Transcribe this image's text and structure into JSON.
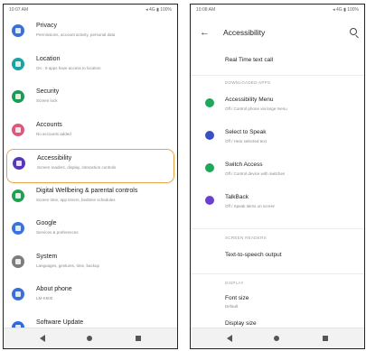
{
  "left_phone": {
    "status": {
      "time": "10:07 AM",
      "icons": "◂ 4G ▮ 100%"
    },
    "items": [
      {
        "title": "Privacy",
        "subtitle": "Permissions, account activity, personal data",
        "color": "#3b6fd9"
      },
      {
        "title": "Location",
        "subtitle": "On · 9 apps have access to location",
        "color": "#19a3a3"
      },
      {
        "title": "Security",
        "subtitle": "Screen lock",
        "color": "#1e9a52"
      },
      {
        "title": "Accounts",
        "subtitle": "No accounts added",
        "color": "#e0577b"
      },
      {
        "title": "Accessibility",
        "subtitle": "Screen readers, display, interaction controls",
        "color": "#5a37b8"
      },
      {
        "title": "Digital Wellbeing & parental controls",
        "subtitle": "Screen time, app timers, bedtime schedules",
        "color": "#21a054"
      },
      {
        "title": "Google",
        "subtitle": "Services & preferences",
        "color": "#3a73e0"
      },
      {
        "title": "System",
        "subtitle": "Languages, gestures, time, backup",
        "color": "#7d7d7d"
      },
      {
        "title": "About phone",
        "subtitle": "LM-K500",
        "color": "#3a6fd8"
      },
      {
        "title": "Software Update",
        "subtitle": "",
        "color": "#2f6ae0"
      }
    ]
  },
  "right_phone": {
    "status": {
      "time": "10:08 AM",
      "icons": "◂ 4G ▮ 100%"
    },
    "title": "Accessibility",
    "rtt_label": "Real Time text call",
    "downloaded_header": "DOWNLOADED APPS",
    "apps": [
      {
        "title": "Accessibility Menu",
        "subtitle": "Off / Control phone via large menu",
        "color": "#1fa75a"
      },
      {
        "title": "Select to Speak",
        "subtitle": "Off / Hear selected text",
        "color": "#3b4fc4"
      },
      {
        "title": "Switch Access",
        "subtitle": "Off / Control device with switches",
        "color": "#1fa75a"
      },
      {
        "title": "TalkBack",
        "subtitle": "Off / Speak items on screen",
        "color": "#6b3fd1"
      }
    ],
    "screen_readers_header": "SCREEN READERS",
    "tts_label": "Text-to-speech output",
    "display_header": "DISPLAY",
    "font_size": {
      "title": "Font size",
      "subtitle": "Default"
    },
    "display_size_label": "Display size"
  }
}
